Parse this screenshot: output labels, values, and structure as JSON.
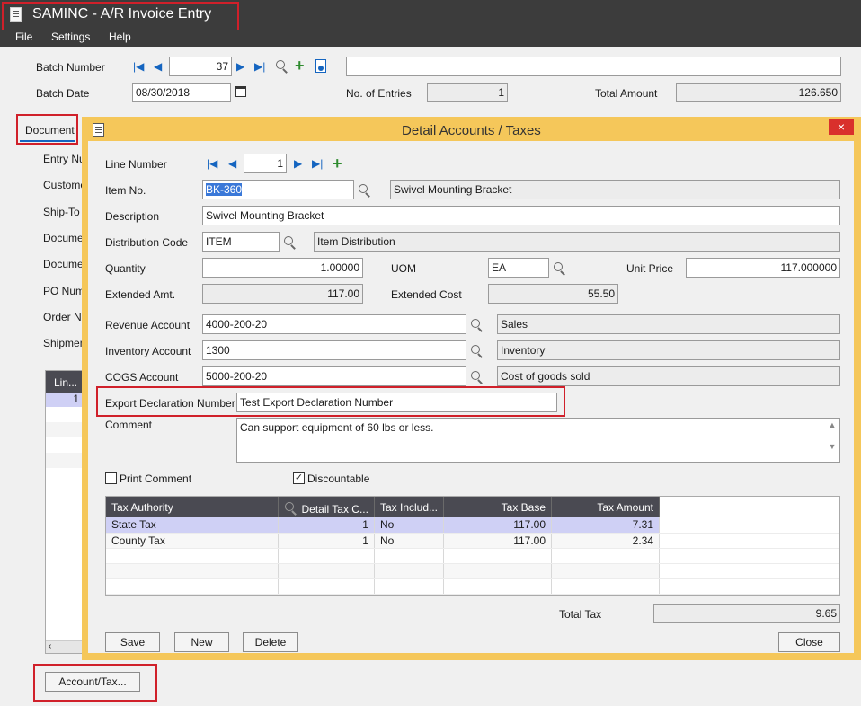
{
  "window": {
    "title": "SAMINC - A/R Invoice Entry"
  },
  "menu": {
    "file": "File",
    "settings": "Settings",
    "help": "Help"
  },
  "header": {
    "batch_number_label": "Batch Number",
    "batch_number": "37",
    "batch_description": "",
    "batch_date_label": "Batch Date",
    "batch_date": "08/30/2018",
    "entries_label": "No. of Entries",
    "entries": "1",
    "total_amount_label": "Total Amount",
    "total_amount": "126.650"
  },
  "left_panel": {
    "document_tab": "Document",
    "labels": [
      "Entry Nur",
      "Customer",
      "Ship-To L",
      "Documen",
      "Documen",
      "PO Numb",
      "Order Nu",
      "Shipment"
    ],
    "grid_header": "Lin...",
    "grid_first_row": "1",
    "account_tax_button": "Account/Tax..."
  },
  "dialog": {
    "title": "Detail Accounts / Taxes",
    "close_x": "×",
    "line_number_label": "Line Number",
    "line_number": "1",
    "item_no_label": "Item No.",
    "item_no": "BK-360",
    "item_desc": "Swivel Mounting Bracket",
    "description_label": "Description",
    "description": "Swivel Mounting Bracket",
    "dist_code_label": "Distribution Code",
    "dist_code": "ITEM",
    "dist_desc": "Item Distribution",
    "quantity_label": "Quantity",
    "quantity": "1.00000",
    "uom_label": "UOM",
    "uom": "EA",
    "unit_price_label": "Unit Price",
    "unit_price": "117.000000",
    "ext_amt_label": "Extended Amt.",
    "ext_amt": "117.00",
    "ext_cost_label": "Extended Cost",
    "ext_cost": "55.50",
    "revenue_label": "Revenue Account",
    "revenue": "4000-200-20",
    "revenue_desc": "Sales",
    "inventory_label": "Inventory Account",
    "inventory": "1300",
    "inventory_desc": "Inventory",
    "cogs_label": "COGS Account",
    "cogs": "5000-200-20",
    "cogs_desc": "Cost of goods sold",
    "export_label": "Export Declaration Number",
    "export_value": "Test Export Declaration Number",
    "comment_label": "Comment",
    "comment": "Can support equipment of 60 lbs or less.",
    "print_comment_label": "Print Comment",
    "discountable_label": "Discountable",
    "discountable_check": "✓",
    "tax_grid": {
      "headers": [
        "Tax Authority",
        "Detail Tax C...",
        "Tax Includ...",
        "Tax Base",
        "Tax Amount"
      ],
      "rows": [
        [
          "State Tax",
          "1",
          "No",
          "117.00",
          "7.31"
        ],
        [
          "County Tax",
          "1",
          "No",
          "117.00",
          "2.34"
        ]
      ]
    },
    "total_tax_label": "Total Tax",
    "total_tax": "9.65",
    "buttons": {
      "save": "Save",
      "new": "New",
      "delete": "Delete",
      "close": "Close"
    }
  },
  "colors": {
    "title_bar": "#3c3c3c",
    "dialog_frame": "#f5c75a",
    "highlight_red": "#d0202a",
    "selected_row": "#cfd0f5"
  }
}
